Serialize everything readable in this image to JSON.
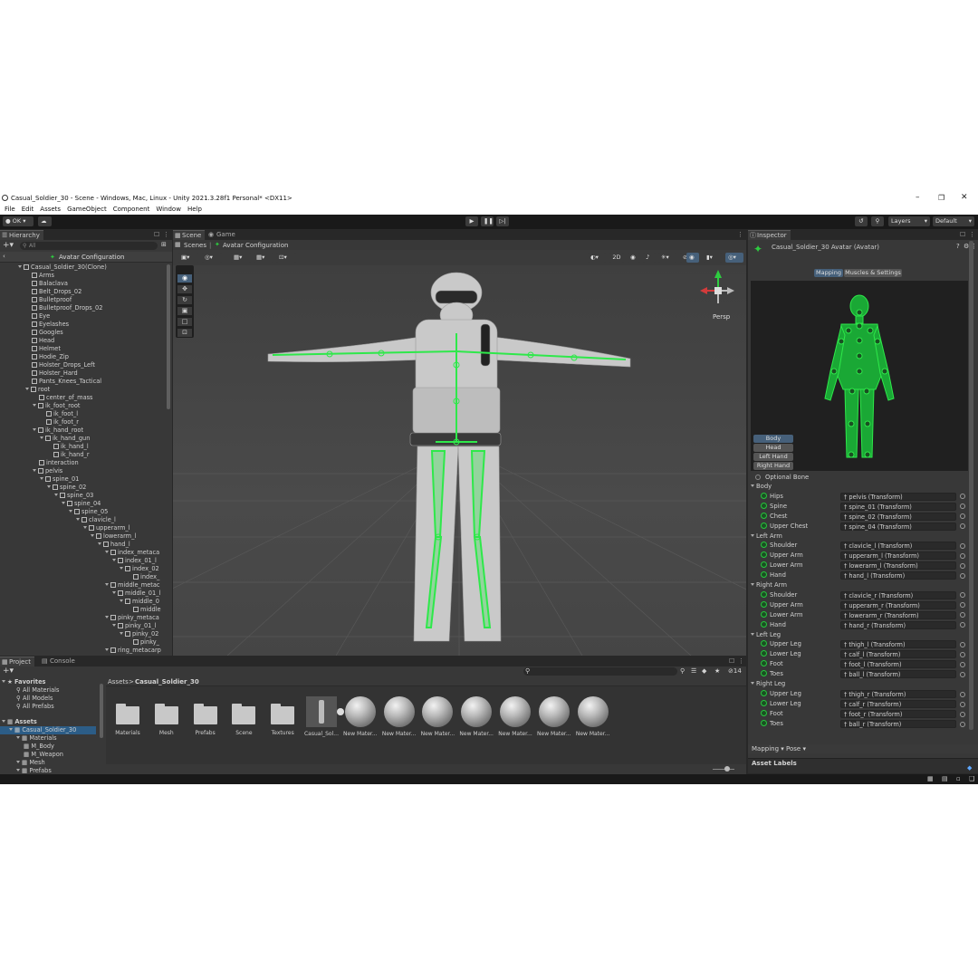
{
  "window": {
    "title": "Casual_Soldier_30 - Scene - Windows, Mac, Linux - Unity 2021.3.28f1 Personal* <DX11>"
  },
  "menu": [
    "File",
    "Edit",
    "Assets",
    "GameObject",
    "Component",
    "Window",
    "Help"
  ],
  "toolbar": {
    "account": "OK",
    "layers": "Layers",
    "layout": "Default"
  },
  "hierarchy": {
    "tab": "Hierarchy",
    "search_placeholder": "All",
    "header": "Avatar Configuration",
    "items": [
      {
        "label": "Casual_Soldier_30(Clone)",
        "indent": 0,
        "arrow": true
      },
      {
        "label": "Arms",
        "indent": 1
      },
      {
        "label": "Balaclava",
        "indent": 1
      },
      {
        "label": "Belt_Drops_02",
        "indent": 1
      },
      {
        "label": "Bulletproof",
        "indent": 1
      },
      {
        "label": "Bulletproof_Drops_02",
        "indent": 1
      },
      {
        "label": "Eye",
        "indent": 1
      },
      {
        "label": "Eyelashes",
        "indent": 1
      },
      {
        "label": "Googles",
        "indent": 1
      },
      {
        "label": "Head",
        "indent": 1
      },
      {
        "label": "Helmet",
        "indent": 1
      },
      {
        "label": "Hodie_Zip",
        "indent": 1
      },
      {
        "label": "Holster_Drops_Left",
        "indent": 1
      },
      {
        "label": "Holster_Hard",
        "indent": 1
      },
      {
        "label": "Pants_Knees_Tactical",
        "indent": 1
      },
      {
        "label": "root",
        "indent": 1,
        "arrow": true
      },
      {
        "label": "center_of_mass",
        "indent": 2
      },
      {
        "label": "ik_foot_root",
        "indent": 2,
        "arrow": true
      },
      {
        "label": "ik_foot_l",
        "indent": 3
      },
      {
        "label": "ik_foot_r",
        "indent": 3
      },
      {
        "label": "ik_hand_root",
        "indent": 2,
        "arrow": true
      },
      {
        "label": "ik_hand_gun",
        "indent": 3,
        "arrow": true
      },
      {
        "label": "ik_hand_l",
        "indent": 4
      },
      {
        "label": "ik_hand_r",
        "indent": 4
      },
      {
        "label": "interaction",
        "indent": 2
      },
      {
        "label": "pelvis",
        "indent": 2,
        "arrow": true
      },
      {
        "label": "spine_01",
        "indent": 3,
        "arrow": true
      },
      {
        "label": "spine_02",
        "indent": 4,
        "arrow": true
      },
      {
        "label": "spine_03",
        "indent": 5,
        "arrow": true
      },
      {
        "label": "spine_04",
        "indent": 6,
        "arrow": true
      },
      {
        "label": "spine_05",
        "indent": 7,
        "arrow": true
      },
      {
        "label": "clavicle_l",
        "indent": 8,
        "arrow": true
      },
      {
        "label": "upperarm_l",
        "indent": 9,
        "arrow": true
      },
      {
        "label": "lowerarm_l",
        "indent": 10,
        "arrow": true
      },
      {
        "label": "hand_l",
        "indent": 11,
        "arrow": true
      },
      {
        "label": "index_metaca",
        "indent": 12,
        "arrow": true
      },
      {
        "label": "index_01_l",
        "indent": 13,
        "arrow": true
      },
      {
        "label": "index_02",
        "indent": 14,
        "arrow": true
      },
      {
        "label": "index_",
        "indent": 15
      },
      {
        "label": "middle_metac",
        "indent": 12,
        "arrow": true
      },
      {
        "label": "middle_01_l",
        "indent": 13,
        "arrow": true
      },
      {
        "label": "middle_0",
        "indent": 14,
        "arrow": true
      },
      {
        "label": "middle",
        "indent": 15
      },
      {
        "label": "pinky_metaca",
        "indent": 12,
        "arrow": true
      },
      {
        "label": "pinky_01_l",
        "indent": 13,
        "arrow": true
      },
      {
        "label": "pinky_02",
        "indent": 14,
        "arrow": true
      },
      {
        "label": "pinky_",
        "indent": 15
      },
      {
        "label": "ring_metacarp",
        "indent": 12,
        "arrow": true
      }
    ]
  },
  "scene": {
    "tabs": [
      "Scene",
      "Game"
    ],
    "breadcrumb": [
      "Scenes",
      "Avatar Configuration"
    ],
    "toggle_2d": "2D",
    "persp": "Persp"
  },
  "inspector": {
    "tab": "Inspector",
    "title": "Casual_Soldier_30 Avatar (Avatar)",
    "tabs": [
      "Mapping",
      "Muscles & Settings"
    ],
    "body_buttons": [
      "Body",
      "Head",
      "Left Hand",
      "Right Hand"
    ],
    "optional_bone": "Optional Bone",
    "groups": [
      {
        "name": "Body",
        "bones": [
          [
            "Hips",
            "pelvis (Transform)"
          ],
          [
            "Spine",
            "spine_01 (Transform)"
          ],
          [
            "Chest",
            "spine_02 (Transform)"
          ],
          [
            "Upper Chest",
            "spine_04 (Transform)"
          ]
        ]
      },
      {
        "name": "Left Arm",
        "bones": [
          [
            "Shoulder",
            "clavicle_l (Transform)"
          ],
          [
            "Upper Arm",
            "upperarm_l (Transform)"
          ],
          [
            "Lower Arm",
            "lowerarm_l (Transform)"
          ],
          [
            "Hand",
            "hand_l (Transform)"
          ]
        ]
      },
      {
        "name": "Right Arm",
        "bones": [
          [
            "Shoulder",
            "clavicle_r (Transform)"
          ],
          [
            "Upper Arm",
            "upperarm_r (Transform)"
          ],
          [
            "Lower Arm",
            "lowerarm_r (Transform)"
          ],
          [
            "Hand",
            "hand_r (Transform)"
          ]
        ]
      },
      {
        "name": "Left Leg",
        "bones": [
          [
            "Upper Leg",
            "thigh_l (Transform)"
          ],
          [
            "Lower Leg",
            "calf_l (Transform)"
          ],
          [
            "Foot",
            "foot_l (Transform)"
          ],
          [
            "Toes",
            "ball_l (Transform)"
          ]
        ]
      },
      {
        "name": "Right Leg",
        "bones": [
          [
            "Upper Leg",
            "thigh_r (Transform)"
          ],
          [
            "Lower Leg",
            "calf_r (Transform)"
          ],
          [
            "Foot",
            "foot_r (Transform)"
          ],
          [
            "Toes",
            "ball_r (Transform)"
          ]
        ]
      }
    ],
    "mapping_dropdown": "Mapping",
    "pose_dropdown": "Pose",
    "asset_labels": "Asset Labels"
  },
  "project": {
    "tabs": [
      "Project",
      "Console"
    ],
    "favorites": {
      "label": "Favorites",
      "items": [
        "All Materials",
        "All Models",
        "All Prefabs"
      ]
    },
    "assets": {
      "label": "Assets",
      "items": [
        {
          "label": "Casual_Soldier_30",
          "indent": 1
        },
        {
          "label": "Materials",
          "indent": 2
        },
        {
          "label": "M_Body",
          "indent": 3
        },
        {
          "label": "M_Weapon",
          "indent": 3
        },
        {
          "label": "Mesh",
          "indent": 2
        },
        {
          "label": "Prefabs",
          "indent": 2
        }
      ]
    },
    "breadcrumb": [
      "Assets",
      "Casual_Soldier_30"
    ],
    "badge_count": "14",
    "grid": [
      {
        "label": "Materials",
        "kind": "folder"
      },
      {
        "label": "Mesh",
        "kind": "folder"
      },
      {
        "label": "Prefabs",
        "kind": "folder"
      },
      {
        "label": "Scene",
        "kind": "folder"
      },
      {
        "label": "Textures",
        "kind": "folder"
      },
      {
        "label": "Casual_Sol...",
        "kind": "model"
      },
      {
        "label": "New Mater...",
        "kind": "material"
      },
      {
        "label": "New Mater...",
        "kind": "material"
      },
      {
        "label": "New Mater...",
        "kind": "material"
      },
      {
        "label": "New Mater...",
        "kind": "material"
      },
      {
        "label": "New Mater...",
        "kind": "material"
      },
      {
        "label": "New Mater...",
        "kind": "material"
      },
      {
        "label": "New Mater...",
        "kind": "material"
      }
    ]
  },
  "colors": {
    "accent": "#2ecc40",
    "selected": "#2c5d87",
    "panel": "#383838"
  }
}
